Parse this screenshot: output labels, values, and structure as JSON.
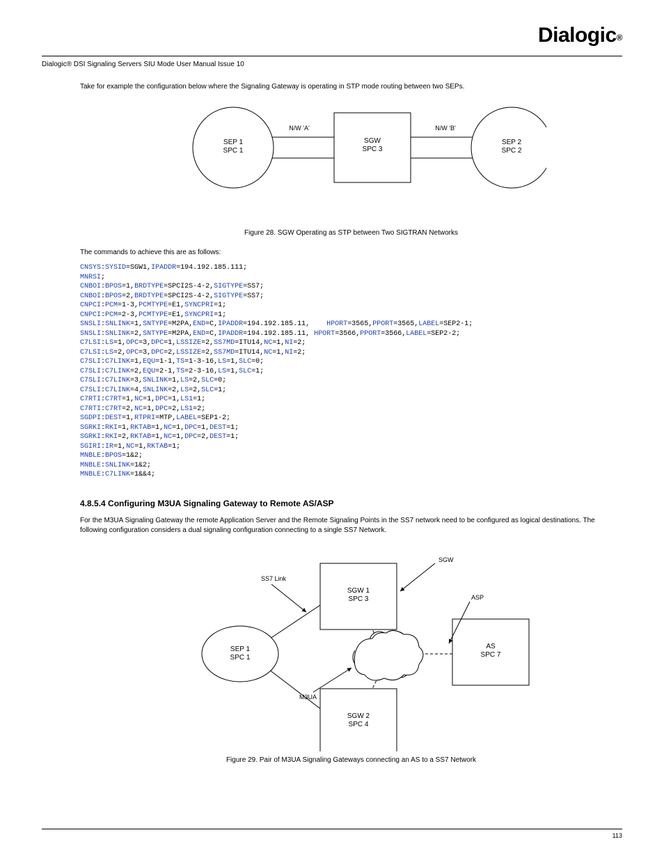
{
  "brand": "Dialogic",
  "doc_title": "Dialogic® DSI Signaling Servers SIU Mode User Manual Issue 10",
  "intro": "Take for example the configuration below where the Signaling Gateway is operating in STP mode routing between two SEPs.",
  "figure1_caption": "Figure 28. SGW Operating as STP between Two SIGTRAN Networks",
  "code_intro": "The commands to achieve this are as follows:",
  "fig1": {
    "left_label": "SEP 1\nSPC 1",
    "center_label": "SGW\nSPC 3",
    "right_label": "SEP 2\nSPC 2",
    "net_left": "N/W 'A'",
    "net_right": "N/W 'B'"
  },
  "code_lines": [
    [
      [
        "kw",
        "CNSYS"
      ],
      [
        "t",
        ":"
      ],
      [
        "kw",
        "SYSID"
      ],
      [
        "t",
        "=SGW1,"
      ],
      [
        "kw",
        "IPADDR"
      ],
      [
        "t",
        "=194.192.185.111;"
      ]
    ],
    [
      [
        "kw",
        "MNRSI"
      ],
      [
        "t",
        ";"
      ]
    ],
    [
      [
        "kw",
        "CNBOI"
      ],
      [
        "t",
        ":"
      ],
      [
        "kw",
        "BPOS"
      ],
      [
        "t",
        "=1,"
      ],
      [
        "kw",
        "BRDTYPE"
      ],
      [
        "t",
        "=SPCI2S-4-2,"
      ],
      [
        "kw",
        "SIGTYPE"
      ],
      [
        "t",
        "=SS7;"
      ]
    ],
    [
      [
        "kw",
        "CNBOI"
      ],
      [
        "t",
        ":"
      ],
      [
        "kw",
        "BPOS"
      ],
      [
        "t",
        "=2,"
      ],
      [
        "kw",
        "BRDTYPE"
      ],
      [
        "t",
        "=SPCI2S-4-2,"
      ],
      [
        "kw",
        "SIGTYPE"
      ],
      [
        "t",
        "=SS7;"
      ]
    ],
    [
      [
        "kw",
        "CNPCI"
      ],
      [
        "t",
        ":"
      ],
      [
        "kw",
        "PCM"
      ],
      [
        "t",
        "=1-3,"
      ],
      [
        "kw",
        "PCMTYPE"
      ],
      [
        "t",
        "=E1,"
      ],
      [
        "kw",
        "SYNCPRI"
      ],
      [
        "t",
        "=1;"
      ]
    ],
    [
      [
        "kw",
        "CNPCI"
      ],
      [
        "t",
        ":"
      ],
      [
        "kw",
        "PCM"
      ],
      [
        "t",
        "=2-3,"
      ],
      [
        "kw",
        "PCMTYPE"
      ],
      [
        "t",
        "=E1,"
      ],
      [
        "kw",
        "SYNCPRI"
      ],
      [
        "t",
        "=1;"
      ]
    ],
    [
      [
        "kw",
        "SNSLI"
      ],
      [
        "t",
        ":"
      ],
      [
        "kw",
        "SNLINK"
      ],
      [
        "t",
        "=1,"
      ],
      [
        "kw",
        "SNTYPE"
      ],
      [
        "t",
        "=M2PA,"
      ],
      [
        "kw",
        "END"
      ],
      [
        "t",
        "=C,"
      ],
      [
        "kw",
        "IPADDR"
      ],
      [
        "t",
        "=194.192.185.11,    "
      ],
      [
        "kw",
        "HPORT"
      ],
      [
        "t",
        "=3565,"
      ],
      [
        "kw",
        "PPORT"
      ],
      [
        "t",
        "=3565,"
      ],
      [
        "kw",
        "LABEL"
      ],
      [
        "t",
        "=SEP2-1;"
      ]
    ],
    [
      [
        "kw",
        "SNSLI"
      ],
      [
        "t",
        ":"
      ],
      [
        "kw",
        "SNLINK"
      ],
      [
        "t",
        "=2,"
      ],
      [
        "kw",
        "SNTYPE"
      ],
      [
        "t",
        "=M2PA,"
      ],
      [
        "kw",
        "END"
      ],
      [
        "t",
        "=C,"
      ],
      [
        "kw",
        "IPADDR"
      ],
      [
        "t",
        "=194.192.185.11, "
      ],
      [
        "kw",
        "HPORT"
      ],
      [
        "t",
        "=3566,"
      ],
      [
        "kw",
        "PPORT"
      ],
      [
        "t",
        "=3566,"
      ],
      [
        "kw",
        "LABEL"
      ],
      [
        "t",
        "=SEP2-2;"
      ]
    ],
    [
      [
        "kw",
        "C7LSI"
      ],
      [
        "t",
        ":"
      ],
      [
        "kw",
        "LS"
      ],
      [
        "t",
        "=1,"
      ],
      [
        "kw",
        "OPC"
      ],
      [
        "t",
        "=3,"
      ],
      [
        "kw",
        "DPC"
      ],
      [
        "t",
        "=1,"
      ],
      [
        "kw",
        "LSSIZE"
      ],
      [
        "t",
        "=2,"
      ],
      [
        "kw",
        "SS7MD"
      ],
      [
        "t",
        "=ITU14,"
      ],
      [
        "kw",
        "NC"
      ],
      [
        "t",
        "=1,"
      ],
      [
        "kw",
        "NI"
      ],
      [
        "t",
        "=2;"
      ]
    ],
    [
      [
        "kw",
        "C7LSI"
      ],
      [
        "t",
        ":"
      ],
      [
        "kw",
        "LS"
      ],
      [
        "t",
        "=2,"
      ],
      [
        "kw",
        "OPC"
      ],
      [
        "t",
        "=3,"
      ],
      [
        "kw",
        "DPC"
      ],
      [
        "t",
        "=2,"
      ],
      [
        "kw",
        "LSSIZE"
      ],
      [
        "t",
        "=2,"
      ],
      [
        "kw",
        "SS7MD"
      ],
      [
        "t",
        "=ITU14,"
      ],
      [
        "kw",
        "NC"
      ],
      [
        "t",
        "=1,"
      ],
      [
        "kw",
        "NI"
      ],
      [
        "t",
        "=2;"
      ]
    ],
    [
      [
        "kw",
        "C7SLI"
      ],
      [
        "t",
        ":"
      ],
      [
        "kw",
        "C7LINK"
      ],
      [
        "t",
        "=1,"
      ],
      [
        "kw",
        "EQU"
      ],
      [
        "t",
        "=1-1,"
      ],
      [
        "kw",
        "TS"
      ],
      [
        "t",
        "=1-3-16,"
      ],
      [
        "kw",
        "LS"
      ],
      [
        "t",
        "=1,"
      ],
      [
        "kw",
        "SLC"
      ],
      [
        "t",
        "=0;"
      ]
    ],
    [
      [
        "kw",
        "C7SLI"
      ],
      [
        "t",
        ":"
      ],
      [
        "kw",
        "C7LINK"
      ],
      [
        "t",
        "=2,"
      ],
      [
        "kw",
        "EQU"
      ],
      [
        "t",
        "=2-1,"
      ],
      [
        "kw",
        "TS"
      ],
      [
        "t",
        "=2-3-16,"
      ],
      [
        "kw",
        "LS"
      ],
      [
        "t",
        "=1,"
      ],
      [
        "kw",
        "SLC"
      ],
      [
        "t",
        "=1;"
      ]
    ],
    [
      [
        "kw",
        "C7SLI"
      ],
      [
        "t",
        ":"
      ],
      [
        "kw",
        "C7LINK"
      ],
      [
        "t",
        "=3,"
      ],
      [
        "kw",
        "SNLINK"
      ],
      [
        "t",
        "=1,"
      ],
      [
        "kw",
        "LS"
      ],
      [
        "t",
        "=2,"
      ],
      [
        "kw",
        "SLC"
      ],
      [
        "t",
        "=0;"
      ]
    ],
    [
      [
        "kw",
        "C7SLI"
      ],
      [
        "t",
        ":"
      ],
      [
        "kw",
        "C7LINK"
      ],
      [
        "t",
        "=4,"
      ],
      [
        "kw",
        "SNLINK"
      ],
      [
        "t",
        "=2,"
      ],
      [
        "kw",
        "LS"
      ],
      [
        "t",
        "=2,"
      ],
      [
        "kw",
        "SLC"
      ],
      [
        "t",
        "=1;"
      ]
    ],
    [
      [
        "kw",
        "C7RTI"
      ],
      [
        "t",
        ":"
      ],
      [
        "kw",
        "C7RT"
      ],
      [
        "t",
        "=1,"
      ],
      [
        "kw",
        "NC"
      ],
      [
        "t",
        "=1,"
      ],
      [
        "kw",
        "DPC"
      ],
      [
        "t",
        "=1,"
      ],
      [
        "kw",
        "LS1"
      ],
      [
        "t",
        "=1;"
      ]
    ],
    [
      [
        "kw",
        "C7RTI"
      ],
      [
        "t",
        ":"
      ],
      [
        "kw",
        "C7RT"
      ],
      [
        "t",
        "=2,"
      ],
      [
        "kw",
        "NC"
      ],
      [
        "t",
        "=1,"
      ],
      [
        "kw",
        "DPC"
      ],
      [
        "t",
        "=2,"
      ],
      [
        "kw",
        "LS1"
      ],
      [
        "t",
        "=2;"
      ]
    ],
    [
      [
        "kw",
        "SGDPI"
      ],
      [
        "t",
        ":"
      ],
      [
        "kw",
        "DEST"
      ],
      [
        "t",
        "=1,"
      ],
      [
        "kw",
        "RTPRI"
      ],
      [
        "t",
        "=MTP,"
      ],
      [
        "kw",
        "LABEL"
      ],
      [
        "t",
        "=SEP1-2;"
      ]
    ],
    [
      [
        "kw",
        "SGRKI"
      ],
      [
        "t",
        ":"
      ],
      [
        "kw",
        "RKI"
      ],
      [
        "t",
        "=1,"
      ],
      [
        "kw",
        "RKTAB"
      ],
      [
        "t",
        "=1,"
      ],
      [
        "kw",
        "NC"
      ],
      [
        "t",
        "=1,"
      ],
      [
        "kw",
        "DPC"
      ],
      [
        "t",
        "=1,"
      ],
      [
        "kw",
        "DEST"
      ],
      [
        "t",
        "=1;"
      ]
    ],
    [
      [
        "kw",
        "SGRKI"
      ],
      [
        "t",
        ":"
      ],
      [
        "kw",
        "RKI"
      ],
      [
        "t",
        "=2,"
      ],
      [
        "kw",
        "RKTAB"
      ],
      [
        "t",
        "=1,"
      ],
      [
        "kw",
        "NC"
      ],
      [
        "t",
        "=1,"
      ],
      [
        "kw",
        "DPC"
      ],
      [
        "t",
        "=2,"
      ],
      [
        "kw",
        "DEST"
      ],
      [
        "t",
        "=1;"
      ]
    ],
    [
      [
        "kw",
        "SGIRI"
      ],
      [
        "t",
        ":"
      ],
      [
        "kw",
        "IR"
      ],
      [
        "t",
        "=1,"
      ],
      [
        "kw",
        "NC"
      ],
      [
        "t",
        "=1,"
      ],
      [
        "kw",
        "RKTAB"
      ],
      [
        "t",
        "=1;"
      ]
    ],
    [
      [
        "kw",
        "MNBLE"
      ],
      [
        "t",
        ":"
      ],
      [
        "kw",
        "BPOS"
      ],
      [
        "t",
        "=1&2;"
      ]
    ],
    [
      [
        "kw",
        "MNBLE"
      ],
      [
        "t",
        ":"
      ],
      [
        "kw",
        "SNLINK"
      ],
      [
        "t",
        "=1&2;"
      ]
    ],
    [
      [
        "kw",
        "MNBLE"
      ],
      [
        "t",
        ":"
      ],
      [
        "kw",
        "C7LINK"
      ],
      [
        "t",
        "=1&&4;"
      ]
    ]
  ],
  "section2_heading": "4.8.5.4  Configuring M3UA Signaling Gateway to Remote AS/ASP",
  "section2_body": "For the M3UA Signaling Gateway the remote Application Server and the Remote Signaling Points in the SS7 network need to be configured as logical destinations. The following configuration considers a dual signaling configuration connecting to a single SS7 Network.",
  "figure2_caption": "Figure 29. Pair of M3UA Signaling Gateways connecting an AS to a SS7 Network",
  "fig2": {
    "left_label": "SEP 1\nSPC 1",
    "sgw1_label": "SGW 1\nSPC 3",
    "sgw2_label": "SGW 2\nSPC 4",
    "as_label": "AS\nSPC 7",
    "arrow_ss7": "SS7 Link",
    "arrow_sgw": "SGW",
    "arrow_m3ua": "M3UA",
    "arrow_asp": "ASP"
  },
  "page_number": "113"
}
